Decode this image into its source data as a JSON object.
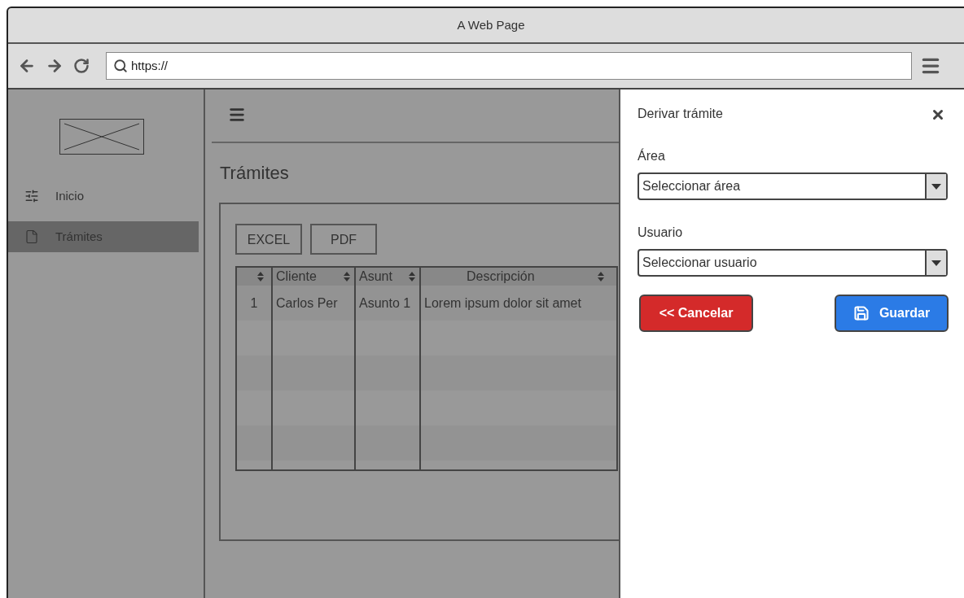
{
  "window": {
    "title": "A Web Page"
  },
  "address_bar": {
    "url": "https://"
  },
  "sidebar": {
    "items": [
      {
        "label": "Inicio",
        "kind": "sliders",
        "selected": false
      },
      {
        "label": "Trámites",
        "kind": "file",
        "selected": true
      }
    ]
  },
  "page": {
    "title": "Trámites",
    "export_buttons": [
      "EXCEL",
      "PDF"
    ],
    "table": {
      "columns": [
        "",
        "Cliente",
        "Asunt",
        "Descripción"
      ],
      "rows": [
        [
          "1",
          "Carlos Per",
          "Asunto 1",
          "Lorem ipsum dolor sit amet"
        ]
      ]
    }
  },
  "drawer": {
    "title": "Derivar trámite",
    "fields": [
      {
        "label": "Área",
        "placeholder": "Seleccionar área"
      },
      {
        "label": "Usuario",
        "placeholder": "Seleccionar usuario"
      }
    ],
    "buttons": [
      {
        "label": "<< Cancelar",
        "kind": "danger"
      },
      {
        "label": "Guardar",
        "kind": "primary"
      }
    ]
  }
}
